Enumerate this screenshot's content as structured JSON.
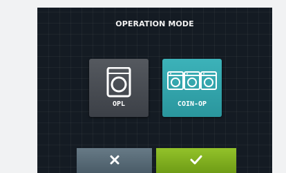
{
  "screen": {
    "title": "OPERATION MODE"
  },
  "modes": [
    {
      "label": "OPL",
      "icon": "washing-machine-icon",
      "selected": false,
      "color": "#4a4e55"
    },
    {
      "label": "COIN-OP",
      "icon": "three-washing-machines-icon",
      "selected": true,
      "color": "#33a6ad"
    }
  ],
  "actions": {
    "cancel": {
      "icon": "close-icon",
      "color": "#5a6c78"
    },
    "confirm": {
      "icon": "check-icon",
      "color": "#82b021"
    }
  }
}
